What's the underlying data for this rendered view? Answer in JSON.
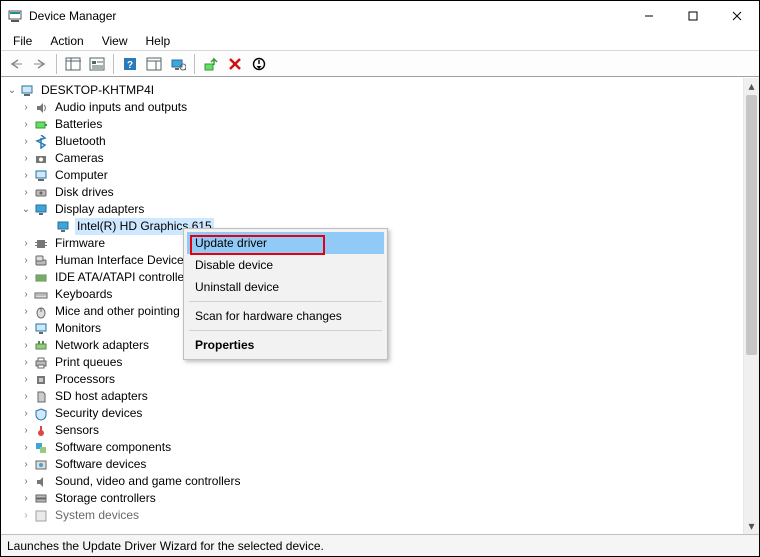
{
  "window": {
    "title": "Device Manager"
  },
  "menu": {
    "file": "File",
    "action": "Action",
    "view": "View",
    "help": "Help"
  },
  "tree": {
    "root": "DESKTOP-KHTMP4I",
    "nodes": {
      "audio": "Audio inputs and outputs",
      "batteries": "Batteries",
      "bluetooth": "Bluetooth",
      "cameras": "Cameras",
      "computer": "Computer",
      "disk": "Disk drives",
      "display": "Display adapters",
      "display_child": "Intel(R) HD Graphics 615",
      "firmware": "Firmware",
      "hid": "Human Interface Devices",
      "ide": "IDE ATA/ATAPI controllers",
      "keyboards": "Keyboards",
      "mice": "Mice and other pointing devices",
      "monitors": "Monitors",
      "network": "Network adapters",
      "printq": "Print queues",
      "processors": "Processors",
      "sdhost": "SD host adapters",
      "security": "Security devices",
      "sensors": "Sensors",
      "swcomp": "Software components",
      "swdev": "Software devices",
      "sound": "Sound, video and game controllers",
      "storage": "Storage controllers",
      "sysdev": "System devices"
    }
  },
  "context_menu": {
    "update": "Update driver",
    "disable": "Disable device",
    "uninstall": "Uninstall device",
    "scan": "Scan for hardware changes",
    "properties": "Properties"
  },
  "status": {
    "text": "Launches the Update Driver Wizard for the selected device."
  }
}
